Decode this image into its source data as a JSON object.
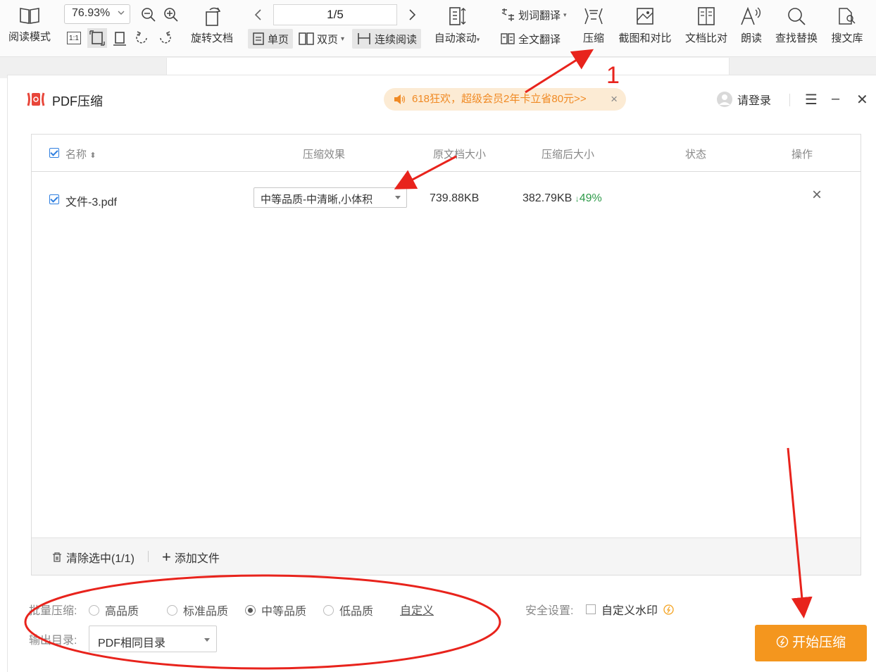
{
  "toolbar": {
    "read_mode": "阅读模式",
    "zoom": "76.93%",
    "rotate_doc": "旋转文档",
    "page_indicator": "1/5",
    "single_page": "单页",
    "double_page": "双页",
    "continuous": "连续阅读",
    "auto_scroll": "自动滚动",
    "word_translate": "划词翻译",
    "full_translate": "全文翻译",
    "compress": "压缩",
    "screenshot_compare": "截图和对比",
    "doc_compare": "文档比对",
    "read_aloud": "朗读",
    "find_replace": "查找替换",
    "search_library": "搜文库"
  },
  "dialog": {
    "title": "PDF压缩",
    "promo": "618狂欢，超级会员2年卡立省80元>>",
    "login": "请登录"
  },
  "table": {
    "headers": {
      "name": "名称",
      "effect": "压缩效果",
      "original_size": "原文档大小",
      "compressed_size": "压缩后大小",
      "status": "状态",
      "action": "操作"
    },
    "rows": [
      {
        "file": "文件-3.pdf",
        "effect": "中等品质-中清晰,小体积",
        "original_size": "739.88KB",
        "compressed_size": "382.79KB",
        "reduction": "49%"
      }
    ],
    "footer": {
      "clear": "清除选中(1/1)",
      "add": "添加文件"
    }
  },
  "options": {
    "batch_label": "批量压缩:",
    "qualities": [
      "高品质",
      "标准品质",
      "中等品质",
      "低品质"
    ],
    "selected_quality": "中等品质",
    "custom": "自定义",
    "security_label": "安全设置:",
    "watermark": "自定义水印",
    "output_label": "输出目录:",
    "output_dir": "PDF相同目录",
    "start": "开始压缩"
  },
  "annotation": {
    "step_number": "1",
    "colors": {
      "arrow": "#e8231c",
      "accent": "#f4961e",
      "link": "#2f7fe0"
    }
  }
}
